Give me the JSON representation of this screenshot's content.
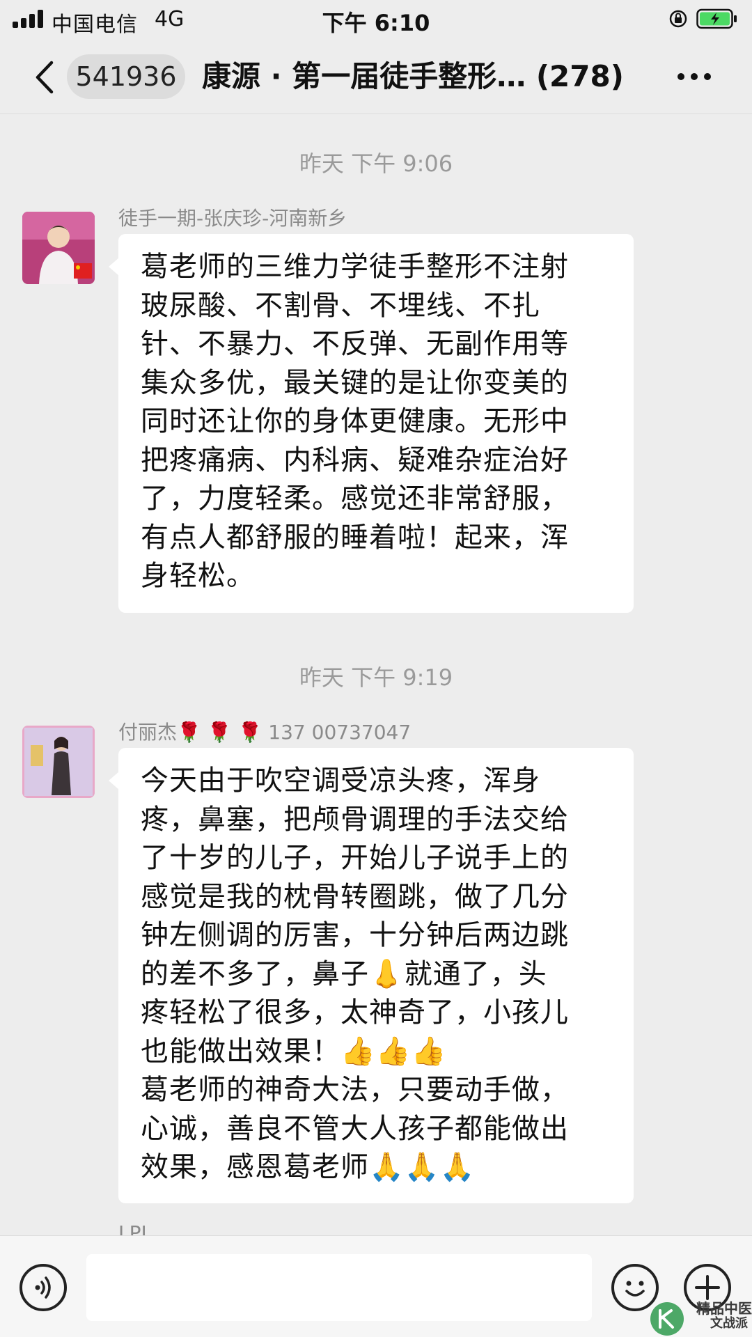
{
  "status_bar": {
    "carrier": "中国电信",
    "network": "4G",
    "time": "下午 6:10"
  },
  "nav": {
    "unread_count": "541936",
    "title": "康源 · 第一届徒手整形… (278)",
    "icons": [
      "back-icon",
      "more-icon"
    ]
  },
  "messages": [
    {
      "timestamp": "昨天 下午 9:06",
      "sender": "徒手一期-张庆珍-河南新乡",
      "lines": [
        "葛老师的三维力学徒手整形不注射",
        "玻尿酸、不割骨、不埋线、不扎",
        "针、不暴力、不反弹、无副作用等",
        "集众多优，最关键的是让你变美的",
        "同时还让你的身体更健康。无形中",
        "把疼痛病、内科病、疑难杂症治好",
        "了，力度轻柔。感觉还非常舒服，",
        "有点人都舒服的睡着啦！起来，浑",
        "身轻松。"
      ]
    },
    {
      "timestamp": "昨天 下午 9:19",
      "sender": "付丽杰🌹 🌹 🌹 137 00737047",
      "lines": [
        "今天由于吹空调受凉头疼，浑身",
        "疼，鼻塞，把颅骨调理的手法交给",
        "了十岁的儿子，开始儿子说手上的",
        "感觉是我的枕骨转圈跳，做了几分",
        "钟左侧调的厉害，十分钟后两边跳",
        "的差不多了，鼻子👃就通了，头",
        "疼轻松了很多，太神奇了，小孩儿",
        "也能做出效果！👍👍👍",
        "葛老师的神奇大法，只要动手做，",
        "心诚，善良不管大人孩子都能做出",
        "效果，感恩葛老师🙏🙏🙏"
      ]
    }
  ],
  "partial_sender": "LPI",
  "input_bar": {
    "placeholder": "",
    "icons": [
      "voice-icon",
      "emoji-icon",
      "plus-icon"
    ]
  },
  "watermark": {
    "line1": "精品中医",
    "line2": "文战派"
  },
  "colors": {
    "background": "#ededed",
    "bubble": "#ffffff",
    "battery_green": "#4cd964"
  }
}
